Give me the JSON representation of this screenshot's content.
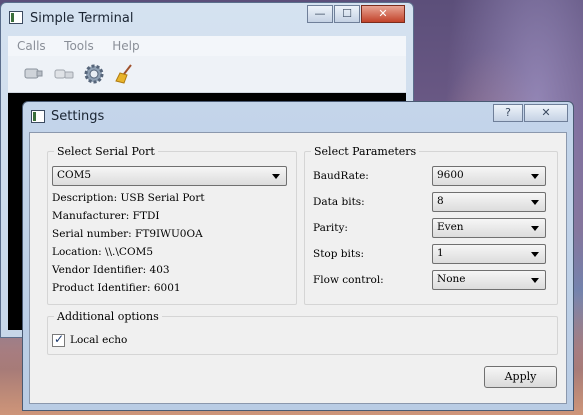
{
  "main_window": {
    "title": "Simple Terminal",
    "icon": "terminal-app-icon",
    "menu": [
      "Calls",
      "Tools",
      "Help"
    ],
    "toolbar_icons": [
      "connect-icon",
      "disconnect-icon",
      "settings-gear-icon",
      "clear-broom-icon"
    ],
    "caption_buttons": {
      "minimize": "—",
      "maximize": "☐",
      "close": "✕"
    }
  },
  "dialog": {
    "title": "Settings",
    "caption_buttons": {
      "help": "?",
      "close": "✕"
    },
    "serial_port": {
      "legend": "Select Serial Port",
      "selected": "COM5",
      "info": [
        "Description: USB Serial Port",
        "Manufacturer: FTDI",
        "Serial number: FT9IWU0OA",
        "Location: \\\\.\\COM5",
        "Vendor Identifier: 403",
        "Product Identifier: 6001"
      ]
    },
    "parameters": {
      "legend": "Select Parameters",
      "fields": [
        {
          "label": "BaudRate:",
          "value": "9600"
        },
        {
          "label": "Data bits:",
          "value": "8"
        },
        {
          "label": "Parity:",
          "value": "Even"
        },
        {
          "label": "Stop bits:",
          "value": "1"
        },
        {
          "label": "Flow control:",
          "value": "None"
        }
      ]
    },
    "additional": {
      "legend": "Additional options",
      "local_echo_label": "Local echo",
      "local_echo_checked": true
    },
    "apply_label": "Apply"
  }
}
